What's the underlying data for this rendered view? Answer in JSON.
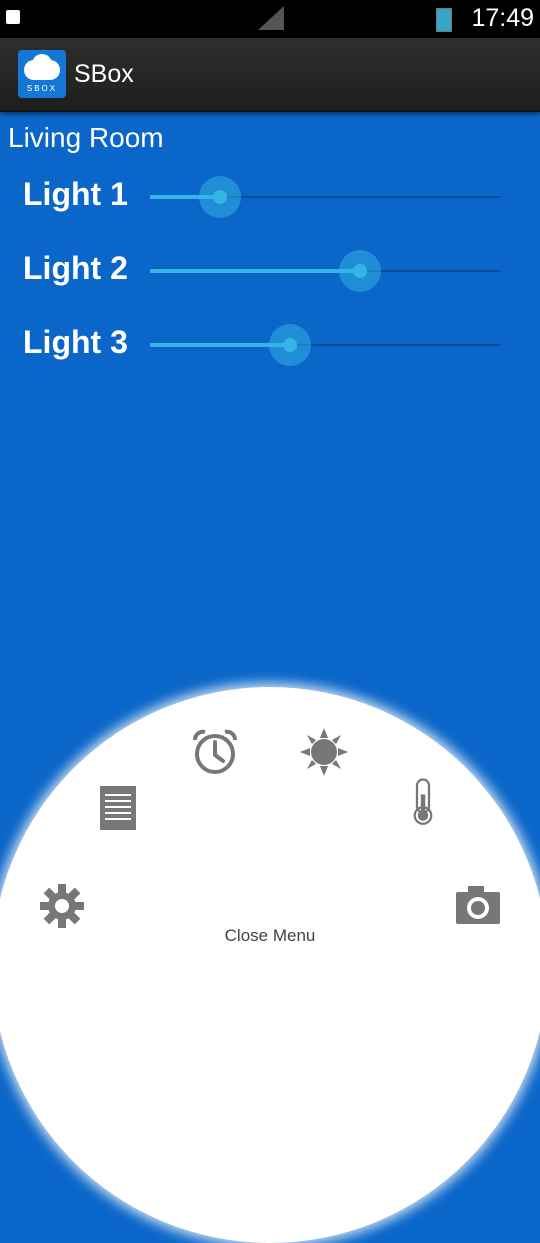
{
  "status_bar": {
    "time": "17:49"
  },
  "app_bar": {
    "title": "SBox",
    "logo_text": "SBOX"
  },
  "room": {
    "title": "Living Room",
    "lights": [
      {
        "label": "Light 1",
        "level": 0.2
      },
      {
        "label": "Light 2",
        "level": 0.6
      },
      {
        "label": "Light 3",
        "level": 0.4
      }
    ]
  },
  "menu": {
    "close_label": "Close Menu",
    "items": [
      "gear-icon",
      "document-icon",
      "alarm-clock-icon",
      "sun-icon",
      "thermometer-icon",
      "camera-icon"
    ]
  },
  "colors": {
    "background": "#0a66c8",
    "accent": "#33b5e5",
    "menu_icon": "#777777"
  }
}
